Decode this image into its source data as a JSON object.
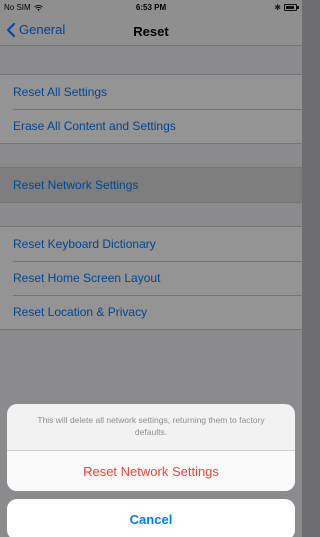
{
  "status_bar": {
    "carrier": "No SIM",
    "time": "6:53 PM",
    "battery_level": 0.9
  },
  "nav": {
    "back_label": "General",
    "title": "Reset"
  },
  "groups": {
    "reset_all_settings": "Reset All Settings",
    "erase_all": "Erase All Content and Settings",
    "reset_network": "Reset Network Settings",
    "reset_keyboard": "Reset Keyboard Dictionary",
    "reset_home_screen": "Reset Home Screen Layout",
    "reset_location_privacy": "Reset Location & Privacy"
  },
  "action_sheet": {
    "message": "This will delete all network settings, returning them to factory defaults.",
    "destructive_label": "Reset Network Settings",
    "cancel_label": "Cancel"
  },
  "colors": {
    "accent": "#007aff",
    "destructive": "#ff3b30",
    "background": "#efeff4"
  },
  "icons": [
    "wifi-icon",
    "bluetooth-icon",
    "battery-icon",
    "chevron-left-icon"
  ]
}
